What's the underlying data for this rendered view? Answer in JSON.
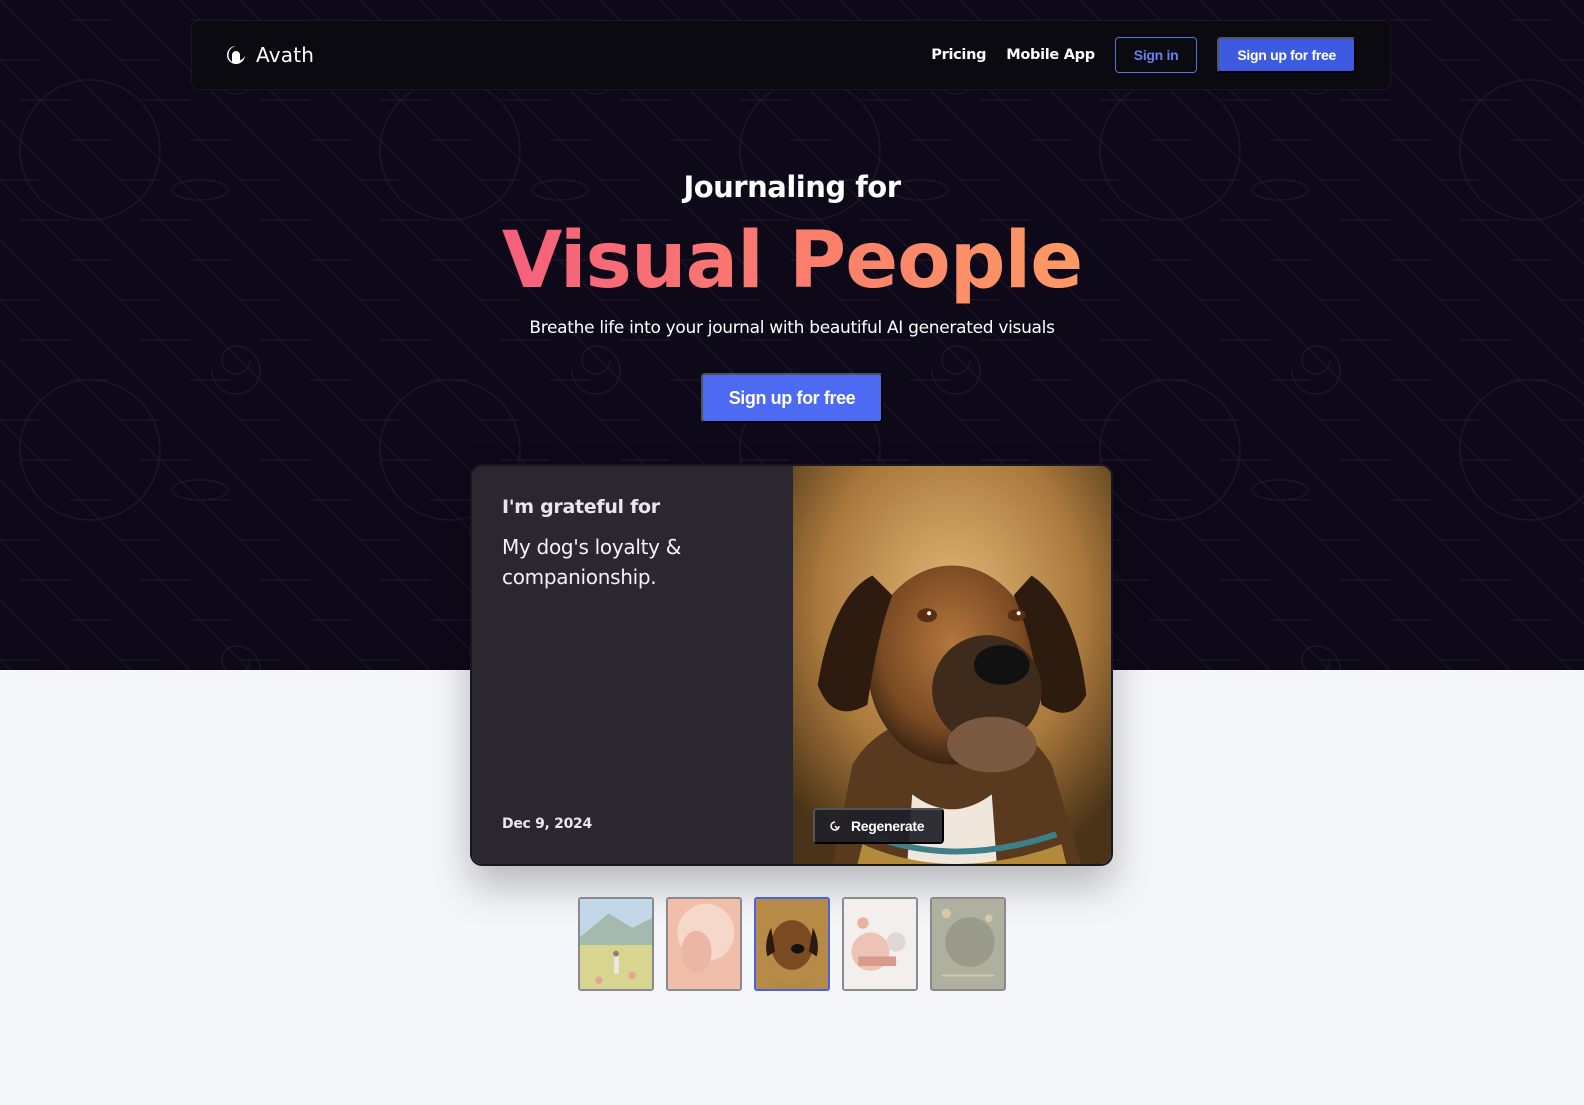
{
  "nav": {
    "brand": "Avath",
    "brand_icon": "crescent-logo-icon",
    "links": [
      {
        "label": "Pricing"
      },
      {
        "label": "Mobile App"
      }
    ],
    "sign_in_label": "Sign in",
    "sign_up_label": "Sign up for free"
  },
  "hero": {
    "subtitle": "Journaling for",
    "title": "Visual People",
    "description": "Breathe life into your journal with beautiful AI generated visuals",
    "cta_label": "Sign up for free"
  },
  "card": {
    "prompt": "I'm grateful for",
    "entry": "My dog's loyalty & companionship.",
    "date": "Dec 9, 2024",
    "regenerate_label": "Regenerate",
    "regenerate_icon": "refresh-icon",
    "image": "dog-portrait"
  },
  "thumbnails": [
    {
      "name": "girl-in-meadow",
      "active": false
    },
    {
      "name": "sunburst-portrait",
      "active": false
    },
    {
      "name": "dog-portrait",
      "active": true
    },
    {
      "name": "whimsical-city",
      "active": false
    },
    {
      "name": "floating-garden-globe",
      "active": false
    }
  ],
  "colors": {
    "accent": "#3c5be0",
    "cta": "#4c6af2",
    "gradient_start": "#f5607d",
    "gradient_end": "#fd9a64",
    "hero_bg": "#0e0918",
    "card_bg": "#2a2730",
    "page_bg": "#f4f6fa"
  }
}
